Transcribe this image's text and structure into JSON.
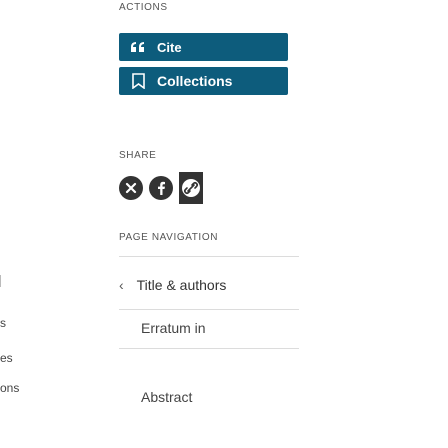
{
  "sidebar_left": {
    "fragments": [
      "s",
      "es",
      "ons"
    ]
  },
  "actions": {
    "heading": "ACTIONS",
    "cite_label": "Cite",
    "collections_label": "Collections"
  },
  "share": {
    "heading": "SHARE",
    "icons": [
      "x-icon",
      "facebook-icon",
      "link-icon"
    ]
  },
  "page_navigation": {
    "heading": "PAGE NAVIGATION",
    "items": [
      {
        "label": "Title & authors",
        "has_chevron": true
      },
      {
        "label": "Erratum in"
      },
      {
        "label": "Abstract"
      }
    ]
  },
  "colors": {
    "button_bg": "#0d5c7c",
    "button_text": "#ffffff"
  }
}
